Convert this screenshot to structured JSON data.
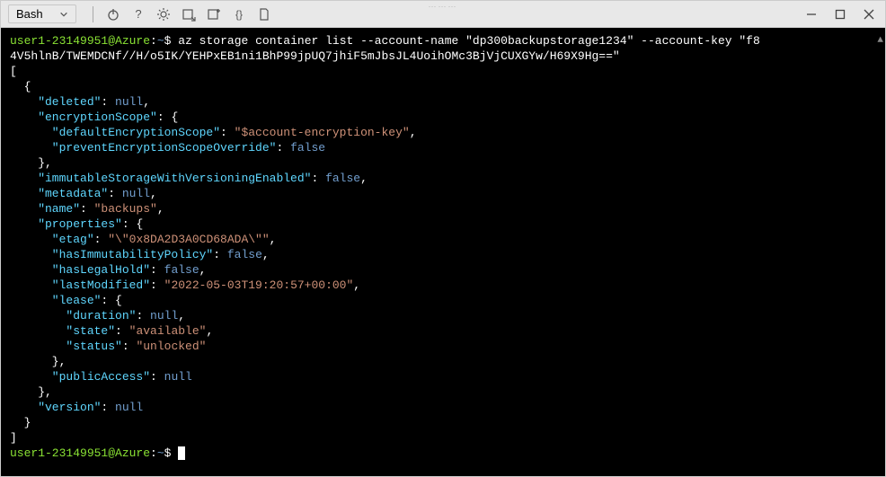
{
  "toolbar": {
    "shell": "Bash"
  },
  "prompt": {
    "userhost": "user1-23149951@Azure",
    "colon": ":",
    "path": "~",
    "sigil": "$"
  },
  "command": {
    "line1": "az storage container list --account-name \"dp300backupstorage1234\" --account-key \"f8",
    "line2": "4V5hlnB/TWEMDCNf//H/o5IK/YEHPxEB1ni1BhP99jpUQ7jhiF5mJbsJL4UoihOMc3BjVjCUXGYw/H69X9Hg==\""
  },
  "json": {
    "open_bracket": "[",
    "open_brace": "  {",
    "deleted_key": "    \"deleted\"",
    "null_val": "null",
    "encscope_key": "    \"encryptionScope\"",
    "brace_open": "{",
    "defenc_key": "      \"defaultEncryptionScope\"",
    "defenc_val": "\"$account-encryption-key\"",
    "prevenc_key": "      \"preventEncryptionScopeOverride\"",
    "false_val": "false",
    "close_brace4": "    },",
    "immut_key": "    \"immutableStorageWithVersioningEnabled\"",
    "metadata_key": "    \"metadata\"",
    "name_key": "    \"name\"",
    "name_val": "\"backups\"",
    "props_key": "    \"properties\"",
    "etag_key": "      \"etag\"",
    "etag_val": "\"\\\"0x8DA2D3A0CD68ADA\\\"\"",
    "hasimm_key": "      \"hasImmutabilityPolicy\"",
    "haslegal_key": "      \"hasLegalHold\"",
    "lastmod_key": "      \"lastModified\"",
    "lastmod_val": "\"2022-05-03T19:20:57+00:00\"",
    "lease_key": "      \"lease\"",
    "duration_key": "        \"duration\"",
    "state_key": "        \"state\"",
    "state_val": "\"available\"",
    "status_key": "        \"status\"",
    "status_val": "\"unlocked\"",
    "close_brace6": "      },",
    "pubaccess_key": "      \"publicAccess\"",
    "version_key": "    \"version\"",
    "close_brace2": "  }",
    "close_bracket": "]"
  }
}
